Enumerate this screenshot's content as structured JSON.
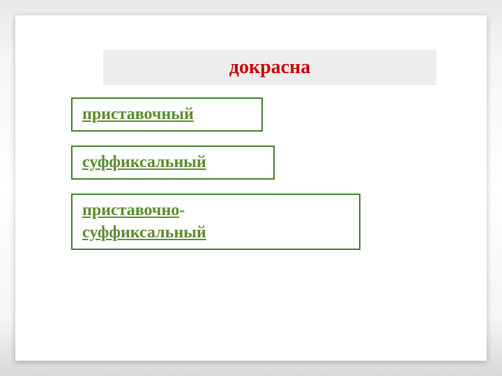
{
  "title": "докрасна",
  "options": [
    {
      "label": "приставочный"
    },
    {
      "label": "суффиксальный"
    },
    {
      "line1": "приставочно",
      "dash": "-",
      "line2": " суффиксальный"
    }
  ]
}
